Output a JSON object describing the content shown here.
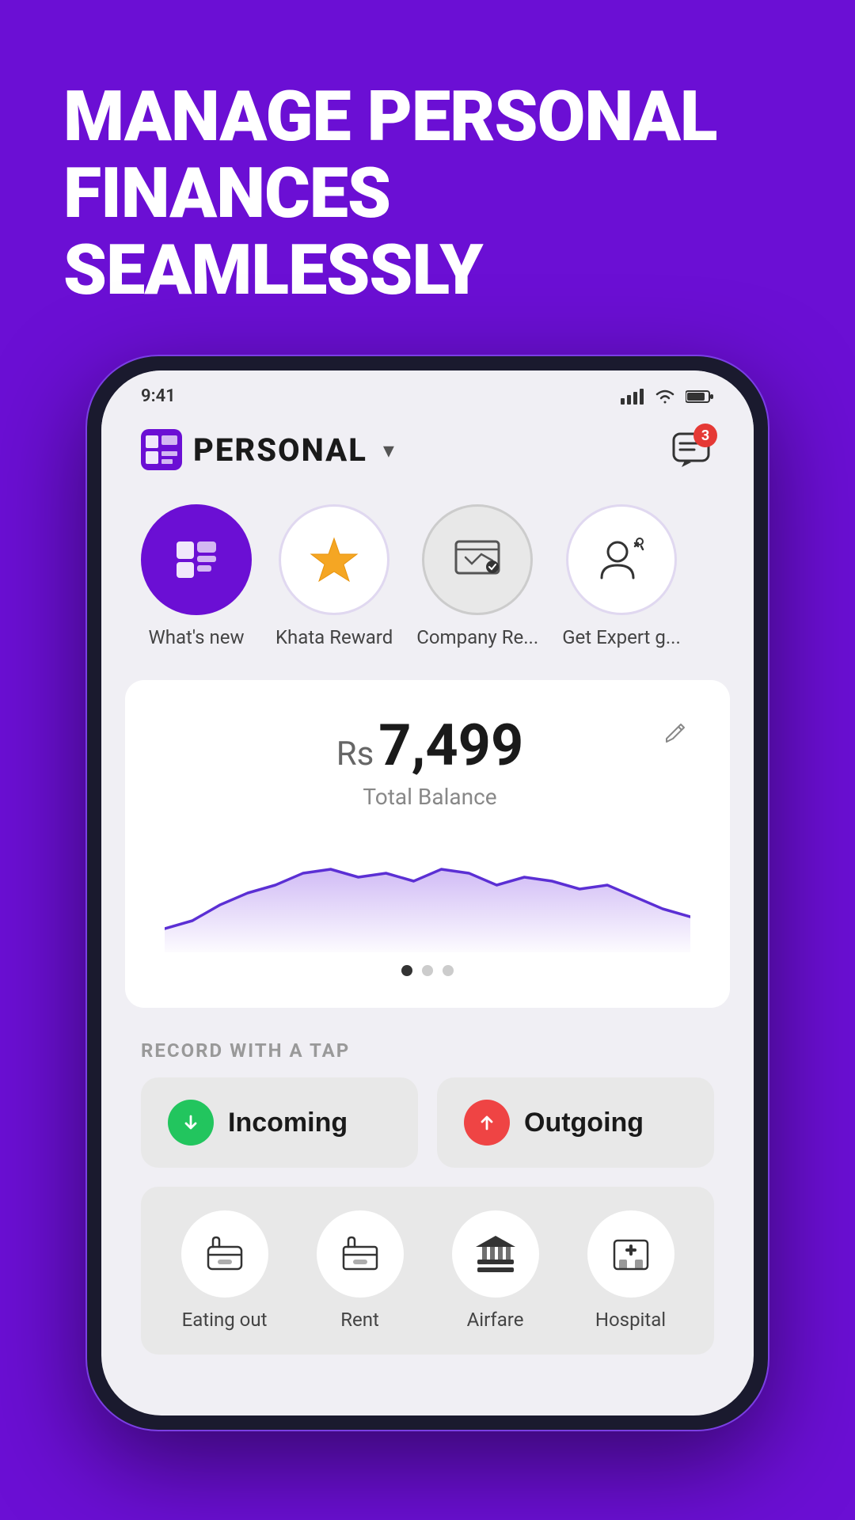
{
  "hero": {
    "line1": "MANAGE PERSONAL",
    "line2": "FINANCES SEAMLESSLY"
  },
  "header": {
    "title": "PERSONAL",
    "notification_count": "3"
  },
  "quick_actions": [
    {
      "id": "whats-new",
      "label": "What's new",
      "style": "purple"
    },
    {
      "id": "khata-reward",
      "label": "Khata Reward",
      "style": "reward"
    },
    {
      "id": "company-re",
      "label": "Company Re...",
      "style": "company"
    },
    {
      "id": "get-expert",
      "label": "Get Expert g...",
      "style": "expert"
    }
  ],
  "balance": {
    "currency": "Rs",
    "amount": "7,499",
    "label": "Total Balance"
  },
  "pagination": {
    "dots": 3,
    "active": 0
  },
  "record_section": {
    "label": "RECORD WITH A TAP",
    "incoming_label": "Incoming",
    "outgoing_label": "Outgoing"
  },
  "categories": [
    {
      "id": "eating-out",
      "label": "Eating out"
    },
    {
      "id": "rent",
      "label": "Rent"
    },
    {
      "id": "airfare",
      "label": "Airfare"
    },
    {
      "id": "hospital",
      "label": "Hospital"
    }
  ]
}
